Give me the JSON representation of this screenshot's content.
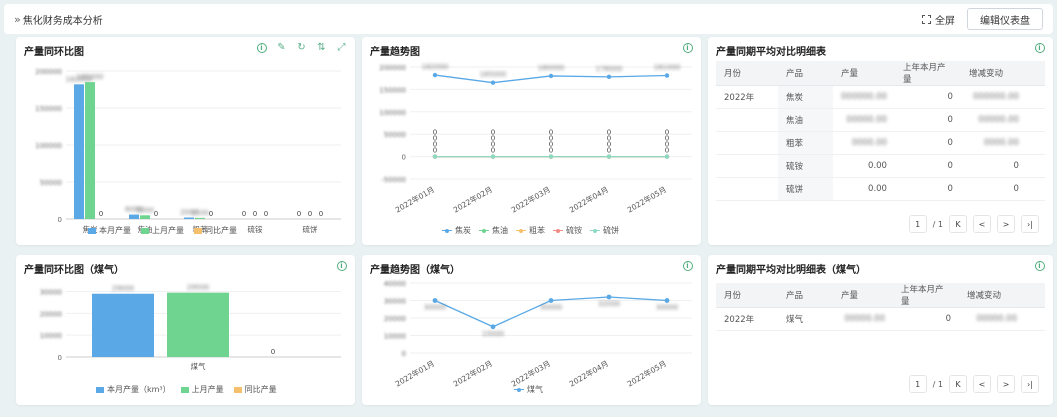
{
  "header": {
    "breadcrumb": "焦化财务成本分析",
    "fullscreen_label": "全屏",
    "edit_label": "编辑仪表盘"
  },
  "colors": {
    "blue": "#5aa9e6",
    "green": "#6fd48f",
    "orange": "#f5c06b",
    "red": "#f28b82",
    "teal": "#8ed9c4",
    "accent": "#4fae7d"
  },
  "panels": {
    "p1": {
      "title": "产量同环比图",
      "tool_icons": [
        "info-icon",
        "brush-icon",
        "refresh-icon",
        "sort-icon",
        "expand-icon"
      ],
      "chart_data": {
        "type": "bar",
        "categories": [
          "焦炭",
          "焦油",
          "粗苯",
          "硫铵",
          "硫饼"
        ],
        "series": [
          {
            "name": "本月产量",
            "values": [
              182000,
              6000,
              2000,
              0,
              0
            ]
          },
          {
            "name": "上月产量",
            "values": [
              185000,
              5000,
              1500,
              0,
              0
            ]
          },
          {
            "name": "同比产量",
            "values": [
              0,
              0,
              0,
              0,
              0
            ]
          }
        ],
        "visible_zero_labels": [
          "0",
          "0",
          "0",
          "0",
          "0",
          "0",
          "0",
          "0",
          "0"
        ],
        "yticks": [
          "0",
          "50000",
          "100000",
          "150000",
          "200000"
        ],
        "ylim": [
          0,
          200000
        ]
      }
    },
    "p2": {
      "title": "产量趋势图",
      "chart_data": {
        "type": "line",
        "x": [
          "2022年01月",
          "2022年02月",
          "2022年03月",
          "2022年04月",
          "2022年05月"
        ],
        "series": [
          {
            "name": "焦炭",
            "values": [
              182000,
              165000,
              180000,
              178000,
              181000
            ]
          },
          {
            "name": "焦油",
            "values": [
              0,
              0,
              0,
              0,
              0
            ]
          },
          {
            "name": "粗苯",
            "values": [
              0,
              0,
              0,
              0,
              0
            ]
          },
          {
            "name": "硫铵",
            "values": [
              0,
              0,
              0,
              0,
              0
            ]
          },
          {
            "name": "硫饼",
            "values": [
              0,
              0,
              0,
              0,
              0
            ]
          }
        ],
        "zero_labels": [
          "0",
          "0",
          "0",
          "0"
        ],
        "yticks": [
          "-50000",
          "0",
          "50000",
          "100000",
          "150000",
          "200000"
        ],
        "ylim": [
          -50000,
          200000
        ]
      }
    },
    "p3": {
      "title": "产量同期平均对比明细表",
      "columns": [
        "月份",
        "产品",
        "产量",
        "上年本月产量",
        "增减变动"
      ],
      "rows": [
        {
          "month": "2022年",
          "product": "焦炭",
          "output": "",
          "last_year": "0",
          "change": ""
        },
        {
          "month": "",
          "product": "焦油",
          "output": "",
          "last_year": "0",
          "change": ""
        },
        {
          "month": "",
          "product": "粗苯",
          "output": "",
          "last_year": "0",
          "change": ""
        },
        {
          "month": "",
          "product": "硫铵",
          "output": "0.00",
          "last_year": "0",
          "change": "0"
        },
        {
          "month": "",
          "product": "硫饼",
          "output": "0.00",
          "last_year": "0",
          "change": "0"
        }
      ],
      "pager": {
        "page": "1",
        "total": "/ 1",
        "first": "K",
        "prev": "<",
        "next": ">",
        "last": "›|"
      }
    },
    "p4": {
      "title": "产量同环比图（煤气）",
      "chart_data": {
        "type": "bar",
        "categories": [
          "煤气"
        ],
        "series": [
          {
            "name": "本月产量（km³）",
            "values": [
              29000
            ]
          },
          {
            "name": "上月产量",
            "values": [
              29500
            ]
          },
          {
            "name": "同比产量",
            "values": [
              0
            ]
          }
        ],
        "value_label": "0",
        "yticks": [
          "0",
          "10000",
          "20000",
          "30000"
        ],
        "ylim": [
          0,
          33000
        ]
      }
    },
    "p5": {
      "title": "产量趋势图（煤气）",
      "chart_data": {
        "type": "line",
        "x": [
          "2022年01月",
          "2022年02月",
          "2022年03月",
          "2022年04月",
          "2022年05月"
        ],
        "series": [
          {
            "name": "煤气",
            "values": [
              30000,
              15000,
              30000,
              32000,
              30000
            ]
          }
        ],
        "ylim": [
          0,
          40000
        ]
      }
    },
    "p6": {
      "title": "产量同期平均对比明细表（煤气）",
      "columns": [
        "月份",
        "产品",
        "产量",
        "上年本月产量",
        "增减变动"
      ],
      "rows": [
        {
          "month": "2022年",
          "product": "煤气",
          "output": "",
          "last_year": "0",
          "change": ""
        }
      ],
      "pager": {
        "page": "1",
        "total": "/ 1",
        "first": "K",
        "prev": "<",
        "next": ">",
        "last": "›|"
      }
    }
  }
}
